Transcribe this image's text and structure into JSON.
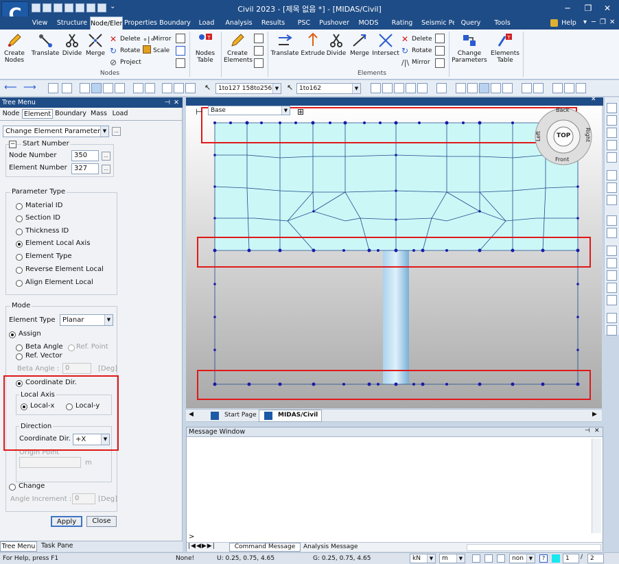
{
  "app": {
    "title": "Civil 2023 - [제목 없음 *] - [MIDAS/Civil]",
    "logo_text": "C"
  },
  "menu_tabs": [
    "View",
    "Structure",
    "Node/Element",
    "Properties",
    "Boundary",
    "Load",
    "Analysis",
    "Results",
    "PSC",
    "Pushover",
    "MODS",
    "Rating",
    "Seismic Pe",
    "Query",
    "Tools"
  ],
  "active_tab": "Node/Element",
  "help_label": "Help",
  "ribbon": {
    "create_nodes": "Create Nodes",
    "translate": "Translate",
    "divide": "Divide",
    "merge": "Merge",
    "delete": "Delete",
    "rotate": "Rotate",
    "project": "Project",
    "mirror": "Mirror",
    "scale": "Scale",
    "nodes_table": "Nodes Table",
    "nodes_group": "Nodes",
    "create_elements": "Create Elements",
    "e_translate": "Translate",
    "e_extrude": "Extrude",
    "e_divide": "Divide",
    "e_merge": "Merge",
    "e_intersect": "Intersect",
    "e_delete": "Delete",
    "e_rotate": "Rotate",
    "e_mirror": "Mirror",
    "change_parameters": "Change Parameters",
    "elements_table": "Elements Table",
    "elements_group": "Elements"
  },
  "toolbar": {
    "node_select": "1to127 158to256",
    "element_select": "1to162"
  },
  "tree_menu": {
    "title": "Tree Menu",
    "tabs": [
      "Node",
      "Element",
      "Boundary",
      "Mass",
      "Load"
    ],
    "active_tab": "Element",
    "function": "Change Element Parameters",
    "start_number": "Start Number",
    "node_number_label": "Node Number",
    "node_number": "350",
    "element_number_label": "Element Number",
    "element_number": "327",
    "parameter_type": "Parameter Type",
    "params": [
      "Material ID",
      "Section ID",
      "Thickness ID",
      "Element Local Axis",
      "Element Type",
      "Reverse Element Local",
      "Align Element Local"
    ],
    "selected_param": "Element Local Axis",
    "mode": "Mode",
    "element_type_label": "Element Type",
    "element_type": "Planar",
    "assign": "Assign",
    "beta_angle_opt": "Beta Angle",
    "ref_point": "Ref. Point",
    "ref_vector": "Ref. Vector",
    "beta_angle_label": "Beta Angle :",
    "beta_angle_value": "0",
    "deg": "[Deg]",
    "coordinate_dir": "Coordinate Dir.",
    "local_axis": "Local Axis",
    "local_x": "Local-x",
    "local_y": "Local-y",
    "direction": "Direction",
    "coordinate_dir_label": "Coordinate Dir.",
    "coordinate_dir_value": "+X",
    "origin_point": "Origin Point",
    "unit_m": "m",
    "change": "Change",
    "angle_increment_label": "Angle Increment :",
    "angle_increment": "0",
    "apply": "Apply",
    "close": "Close"
  },
  "bottom_tabs": [
    "Tree Menu",
    "Task Pane"
  ],
  "viewport": {
    "base": "Base",
    "cube": {
      "back": "Back",
      "front": "Front",
      "left": "Left",
      "right": "Right",
      "top": "TOP"
    }
  },
  "doc_tabs": [
    "Start Page",
    "MIDAS/Civil"
  ],
  "message_window": {
    "title": "Message Window",
    "prompt": ">",
    "tabs": [
      "Command Message",
      "Analysis Message"
    ]
  },
  "status": {
    "help": "For Help, press F1",
    "none": "None!",
    "u": "U: 0.25, 0.75, 4.65",
    "g": "G: 0.25, 0.75, 4.65",
    "force_unit": "kN",
    "length_unit": "m",
    "non": "non",
    "page": "1",
    "total": "2"
  },
  "colors": {
    "titlebar": "#1e4c86",
    "mesh_fill": "#ccf7f7",
    "highlight": "#e01818",
    "node": "#1a1aa8"
  }
}
